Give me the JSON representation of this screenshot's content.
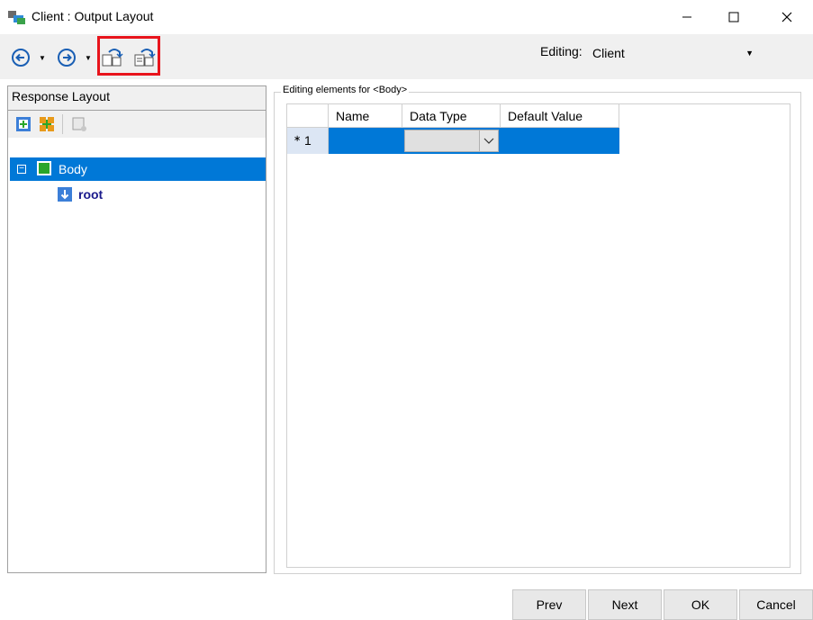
{
  "window": {
    "title": "Client : Output Layout",
    "controls": {
      "minimize": "—",
      "maximize": "☐",
      "close": "✕"
    }
  },
  "toolbar": {
    "back_icon": "back-arrow-icon",
    "forward_icon": "forward-arrow-icon",
    "import_icon": "import-layout-icon",
    "export_icon": "export-layout-icon",
    "highlight_color": "#e8141c",
    "editing_label": "Editing:",
    "editing_value": "Client"
  },
  "left_panel": {
    "header": "Response Layout",
    "tree": {
      "body_label": "Body",
      "expander": "−",
      "root_label": "root"
    },
    "selection_color": "#0078d7"
  },
  "right_panel": {
    "legend": "Editing elements for <Body>",
    "columns": [
      "Name",
      "Data Type",
      "Default Value"
    ],
    "rows": [
      {
        "marker": "∗",
        "number": "1",
        "name": "",
        "data_type": "",
        "default_value": ""
      }
    ]
  },
  "buttons": {
    "prev": "Prev",
    "next": "Next",
    "ok": "OK",
    "cancel": "Cancel"
  }
}
